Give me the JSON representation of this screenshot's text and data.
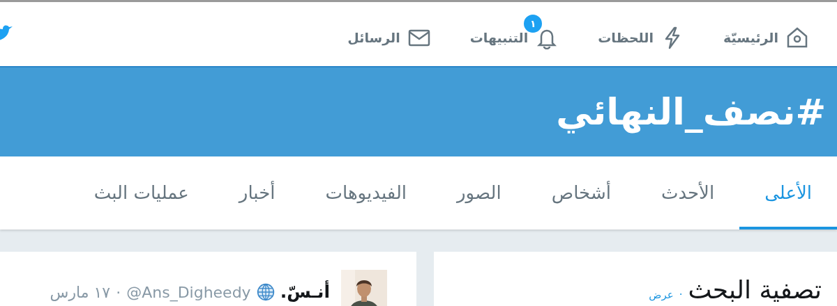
{
  "nav": {
    "items": [
      {
        "kind": "home",
        "label": "الرئيسيّة"
      },
      {
        "kind": "moments",
        "label": "اللحظات"
      },
      {
        "kind": "notifications",
        "label": "التنبيهات",
        "badge": "١"
      },
      {
        "kind": "messages",
        "label": "الرسائل"
      }
    ]
  },
  "banner": {
    "title": "#نصف_النهائي"
  },
  "tabs": [
    {
      "label": "الأعلى",
      "selected": true
    },
    {
      "label": "الأحدث",
      "selected": false
    },
    {
      "label": "أشخاص",
      "selected": false
    },
    {
      "label": "الصور",
      "selected": false
    },
    {
      "label": "الفيديوهات",
      "selected": false
    },
    {
      "label": "أخبار",
      "selected": false
    },
    {
      "label": "عمليات البث",
      "selected": false
    }
  ],
  "filter": {
    "title": "تصفية البحث",
    "separator": "·",
    "link": "عرض"
  },
  "tweet": {
    "name": "أنـسّ.",
    "handle": "@Ans_Digheedy",
    "separator": "·",
    "date": "١٧ مارس"
  }
}
